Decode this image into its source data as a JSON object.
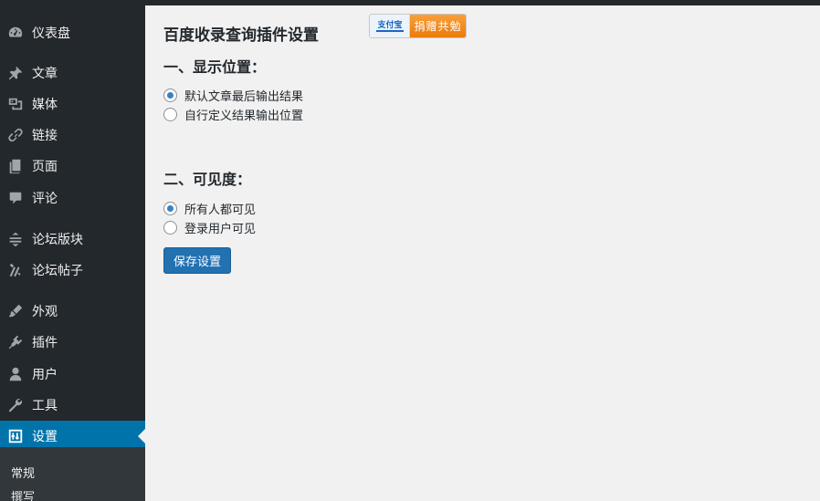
{
  "sidebar": {
    "items": [
      {
        "label": "仪表盘",
        "icon": "dashboard-icon"
      },
      {
        "label": "文章",
        "icon": "pin-icon"
      },
      {
        "label": "媒体",
        "icon": "media-icon"
      },
      {
        "label": "链接",
        "icon": "link-icon"
      },
      {
        "label": "页面",
        "icon": "page-icon"
      },
      {
        "label": "评论",
        "icon": "comment-icon"
      },
      {
        "label": "论坛版块",
        "icon": "forum-icon"
      },
      {
        "label": "论坛帖子",
        "icon": "topic-icon"
      },
      {
        "label": "外观",
        "icon": "appearance-icon"
      },
      {
        "label": "插件",
        "icon": "plugin-icon"
      },
      {
        "label": "用户",
        "icon": "user-icon"
      },
      {
        "label": "工具",
        "icon": "wrench-icon"
      },
      {
        "label": "设置",
        "icon": "settings-icon",
        "active": true
      }
    ],
    "submenu": [
      {
        "label": "常规"
      },
      {
        "label": "撰写"
      }
    ]
  },
  "main": {
    "title": "百度收录查询插件设置",
    "donate": {
      "brand": "支付宝",
      "label": "捐赠共勉"
    },
    "sections": [
      {
        "title": "一、显示位置：",
        "options": [
          {
            "label": "默认文章最后输出结果",
            "checked": true
          },
          {
            "label": "自行定义结果输出位置",
            "checked": false
          }
        ]
      },
      {
        "title": "二、可见度：",
        "options": [
          {
            "label": "所有人都可见",
            "checked": true
          },
          {
            "label": "登录用户可见",
            "checked": false
          }
        ]
      }
    ],
    "save_label": "保存设置"
  },
  "colors": {
    "sidebar_bg": "#23282d",
    "active_bg": "#0073aa",
    "button_bg": "#2271b1",
    "content_bg": "#f1f1f1"
  }
}
